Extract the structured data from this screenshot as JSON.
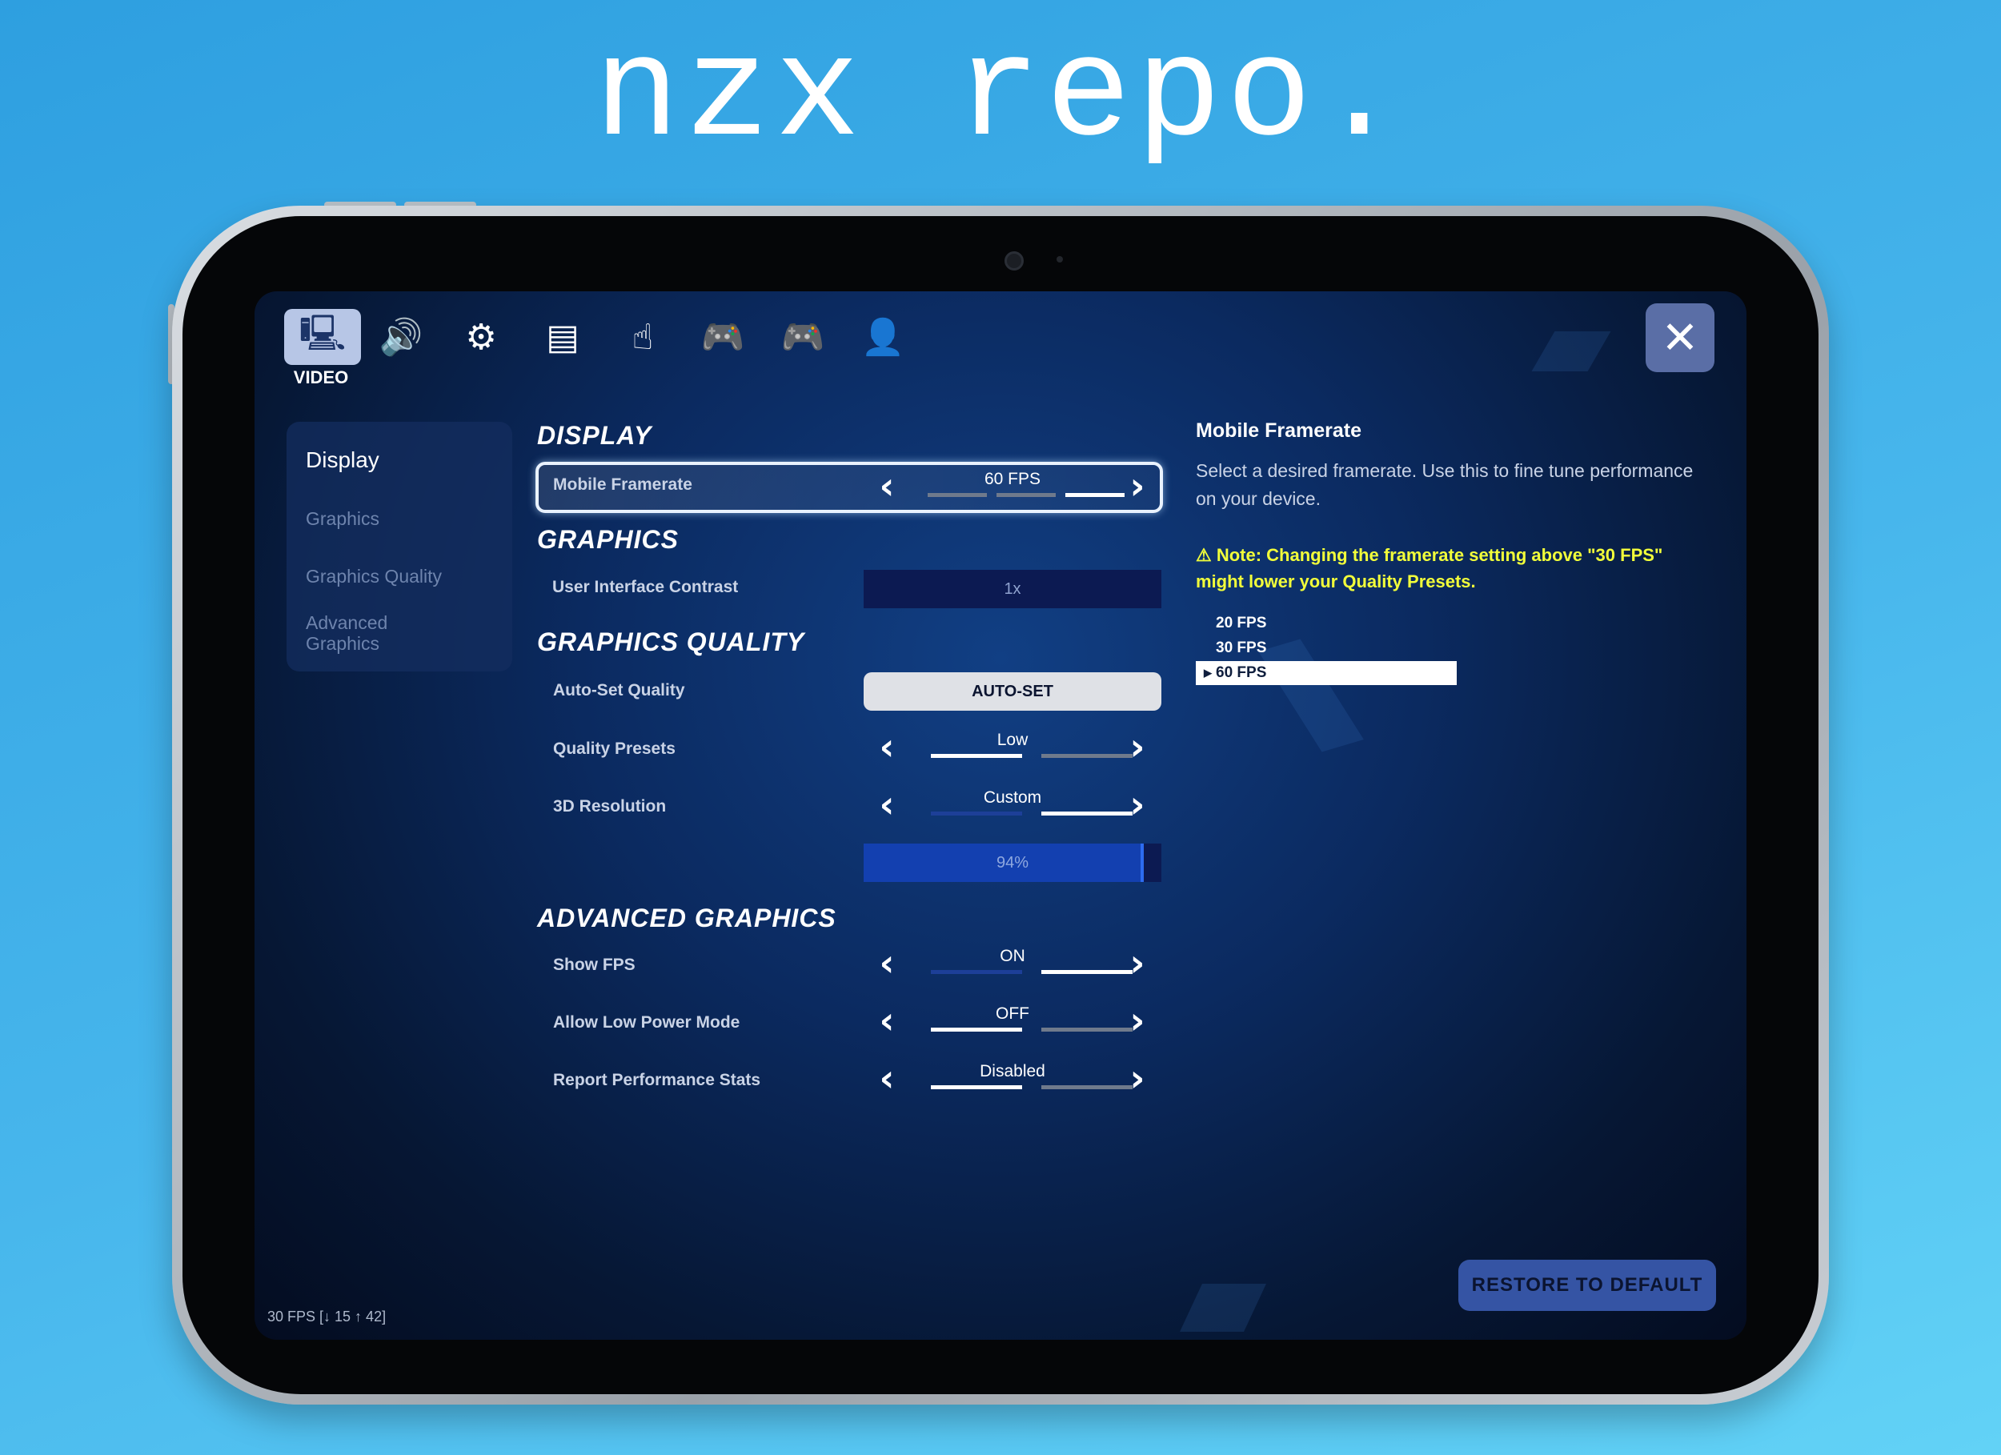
{
  "brand": {
    "title": "nzx repo."
  },
  "nav": {
    "tabs": [
      {
        "name": "video",
        "icon": "🖳",
        "label": "VIDEO",
        "active": true
      },
      {
        "name": "audio",
        "icon": "🔊"
      },
      {
        "name": "game",
        "icon": "⚙"
      },
      {
        "name": "display-ui",
        "icon": "▤"
      },
      {
        "name": "touch",
        "icon": "☝"
      },
      {
        "name": "controller-settings",
        "icon": "🎮"
      },
      {
        "name": "controller",
        "icon": "🎮"
      },
      {
        "name": "account",
        "icon": "👤"
      }
    ],
    "close_icon": "✕"
  },
  "sidebar": {
    "items": [
      "Display",
      "Graphics",
      "Graphics Quality",
      "Advanced Graphics"
    ]
  },
  "sections": {
    "display": "DISPLAY",
    "graphics": "GRAPHICS",
    "graphics_quality": "GRAPHICS QUALITY",
    "advanced_graphics": "ADVANCED GRAPHICS"
  },
  "settings": {
    "mobile_framerate": {
      "label": "Mobile Framerate",
      "value": "60 FPS"
    },
    "ui_contrast": {
      "label": "User Interface Contrast",
      "value": "1x"
    },
    "auto_set_quality": {
      "label": "Auto-Set Quality",
      "button": "AUTO-SET"
    },
    "quality_presets": {
      "label": "Quality Presets",
      "value": "Low"
    },
    "resolution_3d": {
      "label": "3D Resolution",
      "value": "Custom",
      "percent_text": "94%",
      "percent": 94
    },
    "show_fps": {
      "label": "Show FPS",
      "value": "ON"
    },
    "low_power_mode": {
      "label": "Allow Low Power Mode",
      "value": "OFF"
    },
    "report_perf": {
      "label": "Report Performance Stats",
      "value": "Disabled"
    }
  },
  "info": {
    "title": "Mobile Framerate",
    "description": "Select a desired framerate. Use this to fine tune performance on your device.",
    "note": "⚠ Note: Changing the framerate setting above \"30 FPS\" might lower your Quality Presets.",
    "options": [
      "20 FPS",
      "30 FPS",
      "60 FPS"
    ],
    "selected_option": "60 FPS"
  },
  "footer": {
    "restore": "RESTORE TO DEFAULT",
    "fps_counter": "30 FPS [↓ 15 ↑ 42]"
  },
  "colors": {
    "accent": "#b7c6e6",
    "note": "#f2ff3a",
    "button": "#3554a4"
  }
}
